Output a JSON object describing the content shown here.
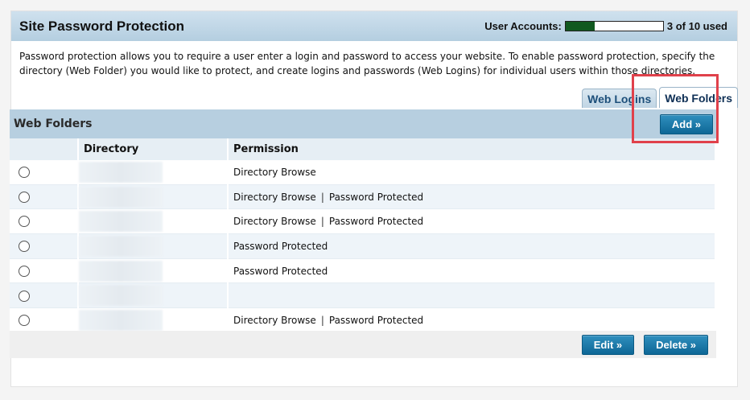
{
  "header": {
    "title": "Site Password Protection",
    "accounts_label": "User Accounts:",
    "accounts_used": 3,
    "accounts_total": 10,
    "accounts_text": "3 of 10 used"
  },
  "description": "Password protection allows you to require a user enter a login and password to access your website. To enable password protection, specify the directory (Web Folder) you would like to protect, and create logins and passwords (Web Logins) for individual users within those directories.",
  "tabs": [
    {
      "label": "Web Logins",
      "active": false
    },
    {
      "label": "Web Folders",
      "active": true
    }
  ],
  "section": {
    "title": "Web Folders",
    "add_label": "Add »"
  },
  "table": {
    "columns": [
      "",
      "Directory",
      "Permission"
    ],
    "rows": [
      {
        "permissions": [
          "Directory Browse"
        ]
      },
      {
        "permissions": [
          "Directory Browse",
          "Password Protected"
        ]
      },
      {
        "permissions": [
          "Directory Browse",
          "Password Protected"
        ]
      },
      {
        "permissions": [
          "Password Protected"
        ]
      },
      {
        "permissions": [
          "Password Protected"
        ]
      },
      {
        "permissions": []
      },
      {
        "permissions": [
          "Directory Browse",
          "Password Protected"
        ]
      }
    ],
    "separator": "|"
  },
  "footer": {
    "edit_label": "Edit »",
    "delete_label": "Delete »"
  },
  "colors": {
    "accent_button": "#0e6796",
    "progress_fill": "#11591f",
    "highlight_box": "#e0414b"
  }
}
